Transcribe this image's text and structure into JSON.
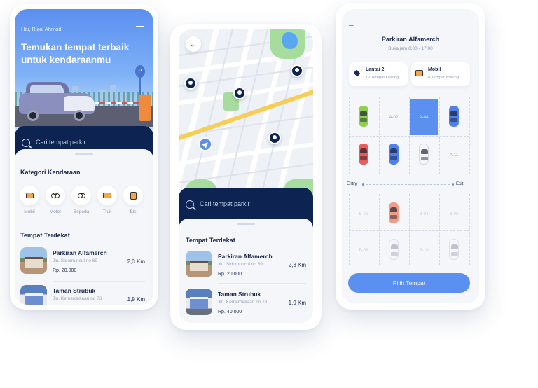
{
  "home": {
    "greeting": "Hai, Rizal Ahmad",
    "headline": "Temukan tempat terbaik untuk kendaraanmu",
    "sign_letter": "P",
    "search_placeholder": "Cari tempat parkir",
    "category_title": "Kategori Kendaraan",
    "categories": [
      {
        "label": "Mobil",
        "icon": "car-icon"
      },
      {
        "label": "Motor",
        "icon": "motorcycle-icon"
      },
      {
        "label": "Sepeda",
        "icon": "bicycle-icon"
      },
      {
        "label": "Truk",
        "icon": "truck-icon"
      },
      {
        "label": "Bis",
        "icon": "bus-icon"
      }
    ],
    "nearby_title": "Tempat Terdekat",
    "places": [
      {
        "name": "Parkiran Alfamerch",
        "address": "Jln. Sidomuncul no 69",
        "price": "Rp. 20,000",
        "distance": "2,3 Km"
      },
      {
        "name": "Taman Strubuk",
        "address": "Jln. Kemerdekaan no 73",
        "price": "",
        "distance": "1,9 Km"
      }
    ]
  },
  "map_screen": {
    "back_icon": "arrow-left-icon",
    "search_placeholder": "Cari tempat parkir",
    "nearby_title": "Tempat Terdekat",
    "places": [
      {
        "name": "Parkiran Alfamerch",
        "address": "Jln. Sidomuncul no 69",
        "price": "Rp. 20,000",
        "distance": "2,3 Km"
      },
      {
        "name": "Taman Strubuk",
        "address": "Jln. Kemerdekaan no 73",
        "price": "Rp. 40,000",
        "distance": "1,9 Km"
      }
    ],
    "colors": {
      "road_highlight": "#f7cd55",
      "park": "#a6dc9e",
      "water": "#5aa6f3",
      "pin": "#0d2453",
      "user": "#5b8ff0"
    }
  },
  "detail": {
    "back_icon": "arrow-left-icon",
    "title": "Parkiran Alfamerch",
    "hours": "Buka jam 8:00 - 17:00",
    "floor_card": {
      "title": "Lantai 2",
      "subtitle": "12 Tempat kosong",
      "icon": "layers-icon"
    },
    "vehicle_card": {
      "title": "Mobil",
      "subtitle": "4 Tempat kosong",
      "icon": "car-icon"
    },
    "slots": {
      "a02": "A-02",
      "a04": "A-04",
      "a11": "A-11",
      "b02": "B-02",
      "b04": "B-04",
      "b05": "B-05",
      "b08": "B-08",
      "b10": "B-10"
    },
    "entry_label": "Entry",
    "exit_label": "Exit",
    "button_label": "Pilih Tempat",
    "colors": {
      "accent": "#5b8ff0",
      "navy": "#0d2453"
    }
  }
}
